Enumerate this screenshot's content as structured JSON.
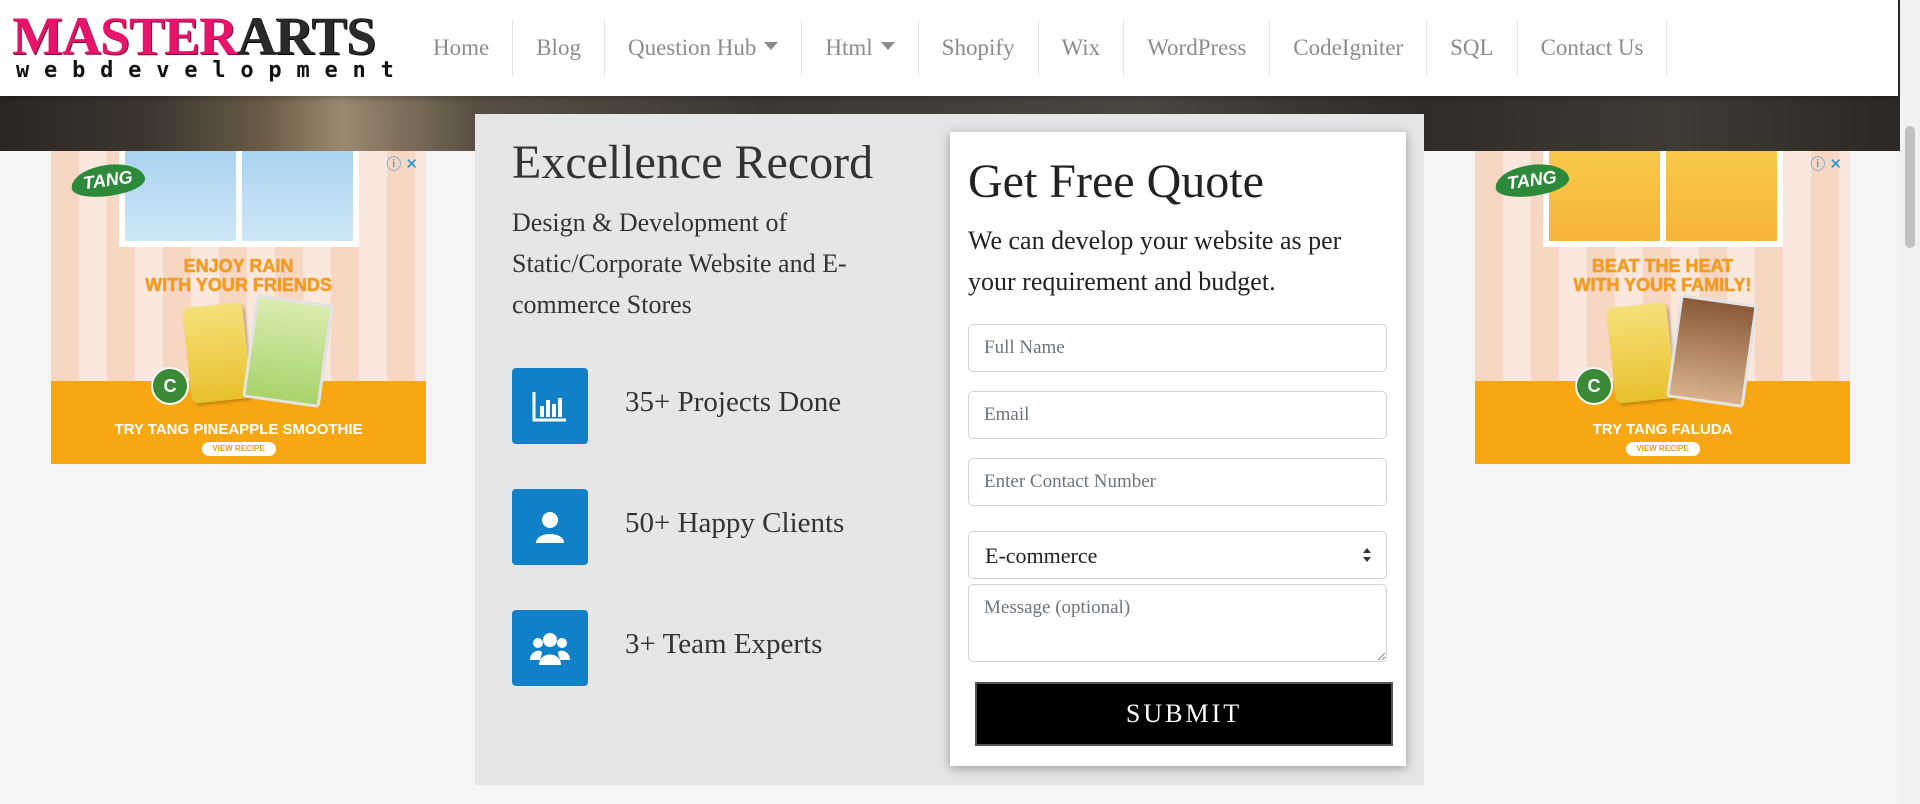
{
  "logo": {
    "part1": "MASTER",
    "part2": "ARTS",
    "tagline": "webdevelopment"
  },
  "nav": {
    "items": [
      {
        "label": "Home",
        "dropdown": false
      },
      {
        "label": "Blog",
        "dropdown": false
      },
      {
        "label": "Question Hub",
        "dropdown": true
      },
      {
        "label": "Html",
        "dropdown": true
      },
      {
        "label": "Shopify",
        "dropdown": false
      },
      {
        "label": "Wix",
        "dropdown": false
      },
      {
        "label": "WordPress",
        "dropdown": false
      },
      {
        "label": "CodeIgniter",
        "dropdown": false
      },
      {
        "label": "SQL",
        "dropdown": false
      },
      {
        "label": "Contact Us",
        "dropdown": false
      }
    ]
  },
  "ads": {
    "left": {
      "brand": "TANG",
      "headline_1": "ENJOY RAIN",
      "headline_2": "WITH YOUR FRIENDS",
      "cta": "TRY TANG PINEAPPLE SMOOTHIE",
      "badge": "C",
      "recipe": "VIEW RECIPE"
    },
    "right": {
      "brand": "TANG",
      "headline_1": "BEAT THE HEAT",
      "headline_2": "WITH YOUR FAMILY!",
      "cta": "TRY TANG FALUDA",
      "badge": "C",
      "recipe": "VIEW RECIPE"
    },
    "info_icon": "ⓘ",
    "close_icon": "✕"
  },
  "excellence": {
    "title": "Excellence Record",
    "description": "Design & Development of Static/Corporate Website and E-commerce Stores",
    "stats": [
      {
        "icon": "bar-chart-icon",
        "label": "35+ Projects Done"
      },
      {
        "icon": "user-icon",
        "label": "50+ Happy Clients"
      },
      {
        "icon": "users-icon",
        "label": "3+ Team Experts"
      }
    ]
  },
  "quote": {
    "title": "Get Free Quote",
    "description": "We can develop your website as per your requirement and budget.",
    "full_name_placeholder": "Full Name",
    "email_placeholder": "Email",
    "contact_placeholder": "Enter Contact Number",
    "service_selected": "E-commerce",
    "message_placeholder": "Message (optional)",
    "submit_label": "SUBMIT"
  },
  "colors": {
    "brand_pink": "#e8146b",
    "accent_blue": "#1080c8",
    "submit_bg": "#000000"
  }
}
